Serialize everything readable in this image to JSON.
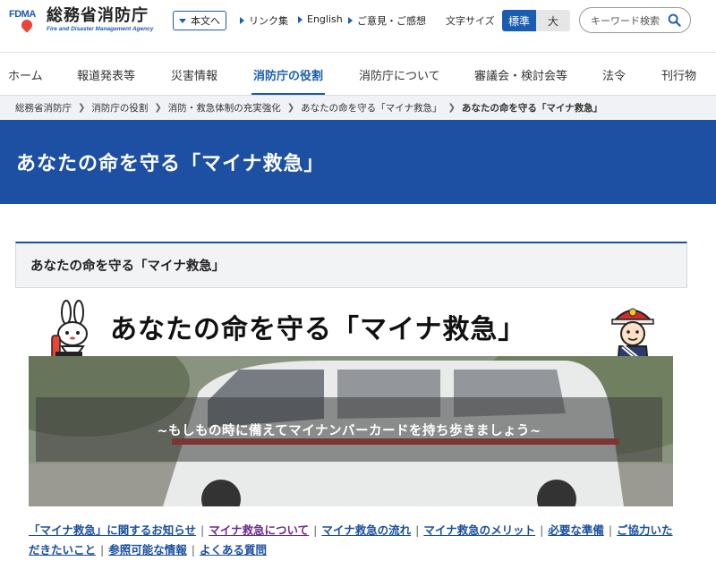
{
  "header": {
    "logo_title": "総務省消防庁",
    "logo_en": "Fire and Disaster Management Agency",
    "logo_mark": "FDMA",
    "logo_sub": "総務省消防庁",
    "honbun_label": "本文へ",
    "links_label": "リンク集",
    "english_label": "English",
    "feedback_label": "ご意見・ご感想",
    "font_size_label": "文字サイズ",
    "font_std": "標準",
    "font_big": "大",
    "search_placeholder": "キーワード検索"
  },
  "nav": [
    {
      "label": "ホーム"
    },
    {
      "label": "報道発表等"
    },
    {
      "label": "災害情報"
    },
    {
      "label": "消防庁の役割"
    },
    {
      "label": "消防庁について"
    },
    {
      "label": "審議会・検討会等"
    },
    {
      "label": "法令"
    },
    {
      "label": "刊行物"
    }
  ],
  "breadcrumb": [
    {
      "label": "総務省消防庁"
    },
    {
      "label": "消防庁の役割"
    },
    {
      "label": "消防・救急体制の充実強化"
    },
    {
      "label": "あなたの命を守る「マイナ救急」"
    },
    {
      "label": "あなたの命を守る「マイナ救急」"
    }
  ],
  "page_title": "あなたの命を守る「マイナ救急」",
  "section_heading": "あなたの命を守る「マイナ救急」",
  "banner": {
    "title": "あなたの命を守る「マイナ救急」",
    "subtitle": "~もしもの時に備えてマイナンバーカードを持ち歩きましょう~"
  },
  "links": [
    {
      "label": "「マイナ救急」に関するお知らせ"
    },
    {
      "label": "マイナ救急について"
    },
    {
      "label": "マイナ救急の流れ"
    },
    {
      "label": "マイナ救急のメリット"
    },
    {
      "label": "必要な準備"
    },
    {
      "label": "ご協力いただきたいこと"
    },
    {
      "label": "参照可能な情報"
    },
    {
      "label": "よくある質問"
    }
  ],
  "colors": {
    "brand_blue": "#1d50a2",
    "link_blue": "#1a4fa0",
    "visited_purple": "#6b2a8c"
  }
}
